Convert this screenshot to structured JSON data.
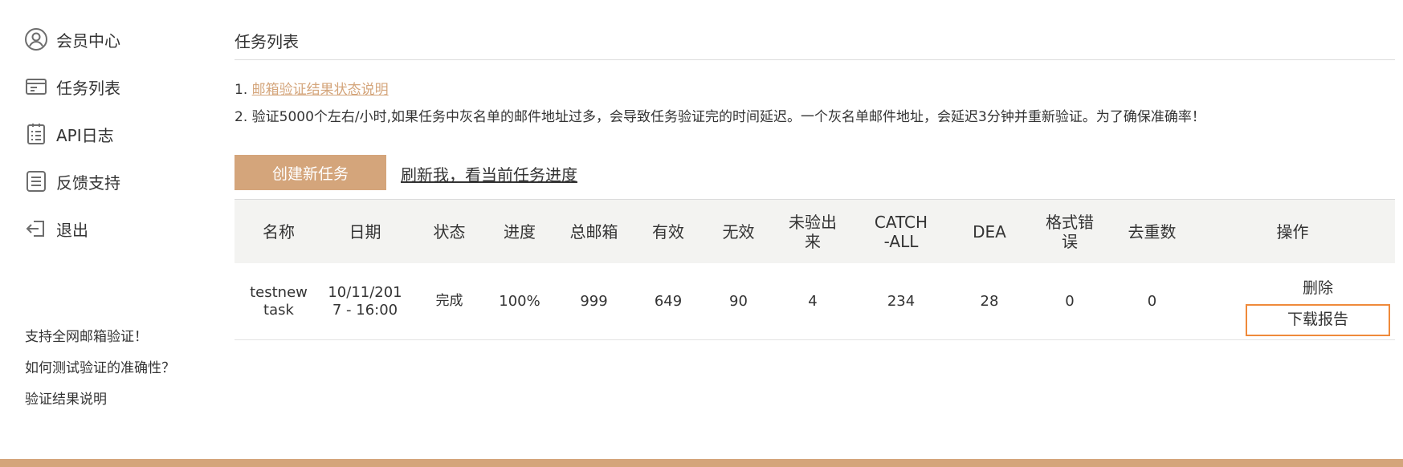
{
  "sidebar": {
    "nav": [
      {
        "label": "会员中心",
        "icon": "user-circle-icon"
      },
      {
        "label": "任务列表",
        "icon": "task-list-icon"
      },
      {
        "label": "API日志",
        "icon": "clipboard-list-icon"
      },
      {
        "label": "反馈支持",
        "icon": "feedback-icon"
      },
      {
        "label": "退出",
        "icon": "logout-icon"
      }
    ],
    "links": [
      {
        "label": "支持全网邮箱验证！"
      },
      {
        "label": "如何测试验证的准确性？"
      },
      {
        "label": "验证结果说明"
      }
    ]
  },
  "main": {
    "title": "任务列表",
    "notes": {
      "n1_prefix": "1. ",
      "n1_link": "邮箱验证结果状态说明",
      "n2": "2. 验证5000个左右/小时,如果任务中灰名单的邮件地址过多，会导致任务验证完的时间延迟。一个灰名单邮件地址，会延迟3分钟并重新验证。为了确保准确率！"
    },
    "create_button": "创建新任务",
    "refresh_link": "刷新我，看当前任务进度"
  },
  "table": {
    "headers": {
      "name": "名称",
      "date": "日期",
      "status": "状态",
      "progress": "进度",
      "total": "总邮箱",
      "valid": "有效",
      "invalid": "无效",
      "unverified_1": "未验出",
      "unverified_2": "来",
      "catchall_1": "CATCH",
      "catchall_2": "-ALL",
      "dea": "DEA",
      "format_1": "格式错",
      "format_2": "误",
      "dedup": "去重数",
      "ops": "操作"
    },
    "rows": [
      {
        "name_1": "testnew",
        "name_2": "task",
        "date_1": "10/11/201",
        "date_2": "7 - 16:00",
        "status": "完成",
        "progress": "100%",
        "total": "999",
        "valid": "649",
        "invalid": "90",
        "unverified": "4",
        "catchall": "234",
        "dea": "28",
        "format": "0",
        "dedup": "0",
        "op_delete": "删除",
        "op_download": "下载报告"
      }
    ]
  },
  "colors": {
    "accent": "#d4a57b",
    "highlight_border": "#ef8a3a",
    "header_bg": "#f3f3f1"
  }
}
